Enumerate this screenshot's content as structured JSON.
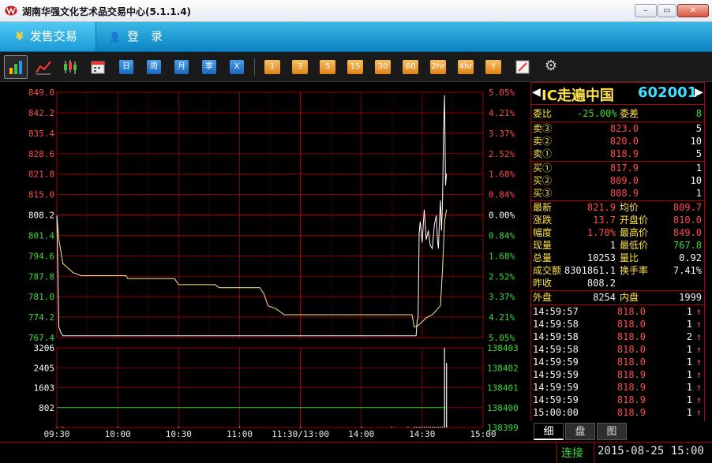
{
  "window": {
    "title": "湖南华强文化艺术品交易中心(5.1.1.4)",
    "minimize": "–",
    "restore": "▭",
    "close": "✕"
  },
  "nav": {
    "tabs": [
      {
        "icon": "¥",
        "label": "发售交易"
      },
      {
        "icon": "👤",
        "label": "登　录"
      }
    ]
  },
  "toolbar": {
    "period_buttons": [
      "日",
      "周",
      "月",
      "季",
      "X"
    ],
    "minute_buttons": [
      "1",
      "3",
      "5",
      "15",
      "30",
      "60",
      "2hr",
      "4hr",
      "Y"
    ]
  },
  "stock": {
    "name": "IC走遍中国",
    "code": "602001",
    "prev_arrow": "◀",
    "next_arrow": "▶"
  },
  "quote": {
    "weibi": {
      "label": "委比",
      "value": "-25.00%",
      "label2": "委差",
      "value2": "8"
    },
    "asks": [
      {
        "label": "卖③",
        "price": "823.0",
        "vol": "5"
      },
      {
        "label": "卖②",
        "price": "820.0",
        "vol": "10"
      },
      {
        "label": "卖①",
        "price": "818.9",
        "vol": "5"
      }
    ],
    "bids": [
      {
        "label": "买①",
        "price": "817.9",
        "vol": "1"
      },
      {
        "label": "买②",
        "price": "809.0",
        "vol": "10"
      },
      {
        "label": "买③",
        "price": "808.9",
        "vol": "1"
      }
    ],
    "stats": [
      {
        "l1": "最新",
        "v1": "821.9",
        "l2": "均价",
        "v2": "809.7"
      },
      {
        "l1": "涨跌",
        "v1": "13.7",
        "l2": "开盘价",
        "v2": "810.0"
      },
      {
        "l1": "幅度",
        "v1": "1.70%",
        "l2": "最高价",
        "v2": "849.0"
      },
      {
        "l1": "现量",
        "v1": "1",
        "l2": "最低价",
        "v2": "767.8"
      },
      {
        "l1": "总量",
        "v1": "10253",
        "l2": "量比",
        "v2": "0.92"
      },
      {
        "l1": "成交额",
        "v1": "8301861.1",
        "l2": "换手率",
        "v2": "7.41%"
      },
      {
        "l1": "昨收",
        "v1": "808.2",
        "l2": "",
        "v2": ""
      }
    ],
    "outer": {
      "label": "外盘",
      "value": "8254",
      "label2": "内盘",
      "value2": "1999"
    },
    "ticks": [
      {
        "time": "14:59:57",
        "price": "818.0",
        "vol": "1"
      },
      {
        "time": "14:59:58",
        "price": "818.0",
        "vol": "1"
      },
      {
        "time": "14:59:58",
        "price": "818.0",
        "vol": "2"
      },
      {
        "time": "14:59:58",
        "price": "818.0",
        "vol": "1"
      },
      {
        "time": "14:59:59",
        "price": "818.0",
        "vol": "1"
      },
      {
        "time": "14:59:59",
        "price": "818.9",
        "vol": "1"
      },
      {
        "time": "14:59:59",
        "price": "818.9",
        "vol": "1"
      },
      {
        "time": "14:59:59",
        "price": "818.9",
        "vol": "1"
      },
      {
        "time": "15:00:00",
        "price": "818.9",
        "vol": "1"
      }
    ],
    "tick_arrow": "↑"
  },
  "quote_tabs": [
    "细",
    "盘",
    "图"
  ],
  "status": {
    "connection": "连接",
    "datetime": "2015-08-25 15:00"
  },
  "colors": {
    "grid": "#a00000",
    "price_line": "#ffffff",
    "avg_line": "#ffe98a",
    "volume": "#ffffff",
    "vol_avg": "#32c832",
    "up": "#ff4b4b",
    "down": "#3cdc3c",
    "label": "#ffe14a",
    "accent": "#3fe0ff"
  },
  "chart_data": {
    "type": "line",
    "price_axis": {
      "labels": [
        "849.0",
        "842.2",
        "835.4",
        "828.6",
        "821.8",
        "815.0",
        "808.2",
        "801.4",
        "794.6",
        "787.8",
        "781.0",
        "774.2",
        "767.4"
      ],
      "ylim": [
        767.4,
        849.0
      ],
      "ref": 808.2
    },
    "pct_axis": {
      "labels": [
        "5.05%",
        "4.21%",
        "3.37%",
        "2.52%",
        "1.68%",
        "0.84%",
        "0.00%",
        "0.84%",
        "1.68%",
        "2.52%",
        "3.37%",
        "4.21%",
        "5.05%"
      ]
    },
    "volume_axis": {
      "labels": [
        "3206",
        "2405",
        "1603",
        "802"
      ],
      "ylim": [
        0,
        3206
      ]
    },
    "volume_right_axis": {
      "labels": [
        "138403",
        "138402",
        "138401",
        "138400",
        "138399"
      ]
    },
    "time_axis": {
      "labels": [
        "09:30",
        "10:00",
        "10:30",
        "11:00",
        "11:30/13:00",
        "14:00",
        "14:30",
        "15:00"
      ],
      "minutes": [
        0,
        30,
        60,
        90,
        120,
        150,
        180,
        210
      ]
    },
    "price_series": [
      [
        0,
        808
      ],
      [
        1,
        771
      ],
      [
        2,
        769
      ],
      [
        3,
        768
      ],
      [
        8,
        768
      ],
      [
        20,
        768
      ],
      [
        60,
        768
      ],
      [
        120,
        768
      ],
      [
        150,
        768
      ],
      [
        175,
        768
      ],
      [
        177,
        768
      ],
      [
        177.5,
        773
      ],
      [
        178,
        774
      ],
      [
        178.5,
        802
      ],
      [
        179,
        806
      ],
      [
        180,
        799
      ],
      [
        181,
        810
      ],
      [
        182,
        800
      ],
      [
        183,
        803
      ],
      [
        184,
        798
      ],
      [
        185,
        797
      ],
      [
        186,
        805
      ],
      [
        187,
        808
      ],
      [
        187.5,
        800
      ],
      [
        188,
        797
      ],
      [
        188.5,
        806
      ],
      [
        189,
        813
      ],
      [
        189.5,
        803
      ],
      [
        190,
        812
      ],
      [
        190.5,
        835
      ],
      [
        191,
        848
      ],
      [
        191.5,
        818
      ],
      [
        192,
        822
      ]
    ],
    "avg_series": [
      [
        0,
        808
      ],
      [
        1,
        800
      ],
      [
        3,
        792
      ],
      [
        8,
        789
      ],
      [
        12,
        788
      ],
      [
        34,
        788
      ],
      [
        35,
        787
      ],
      [
        58,
        787
      ],
      [
        60,
        785
      ],
      [
        78,
        785
      ],
      [
        80,
        784
      ],
      [
        100,
        784
      ],
      [
        102,
        782
      ],
      [
        104,
        778
      ],
      [
        108,
        777
      ],
      [
        112,
        775
      ],
      [
        130,
        775
      ],
      [
        150,
        775
      ],
      [
        175,
        775
      ],
      [
        176,
        771
      ],
      [
        177,
        771
      ],
      [
        179,
        772
      ],
      [
        182,
        774
      ],
      [
        185,
        775
      ],
      [
        189,
        778
      ],
      [
        190,
        790
      ],
      [
        191,
        806
      ],
      [
        192,
        810
      ]
    ],
    "volume_series": [
      [
        0,
        2
      ],
      [
        3,
        1
      ],
      [
        30,
        1
      ],
      [
        60,
        1
      ],
      [
        90,
        1
      ],
      [
        120,
        1
      ],
      [
        150,
        2
      ],
      [
        165,
        1
      ],
      [
        173,
        1
      ],
      [
        176,
        5
      ],
      [
        177,
        3
      ],
      [
        178,
        6
      ],
      [
        179,
        4
      ],
      [
        180,
        3
      ],
      [
        181,
        2
      ],
      [
        182,
        1
      ],
      [
        183,
        7
      ],
      [
        184,
        3
      ],
      [
        185,
        2
      ],
      [
        186,
        4
      ],
      [
        187,
        3
      ],
      [
        188,
        5
      ],
      [
        189,
        9
      ],
      [
        190,
        40
      ],
      [
        191,
        3206
      ],
      [
        192,
        2600
      ]
    ],
    "vol_avg_level": 802
  }
}
